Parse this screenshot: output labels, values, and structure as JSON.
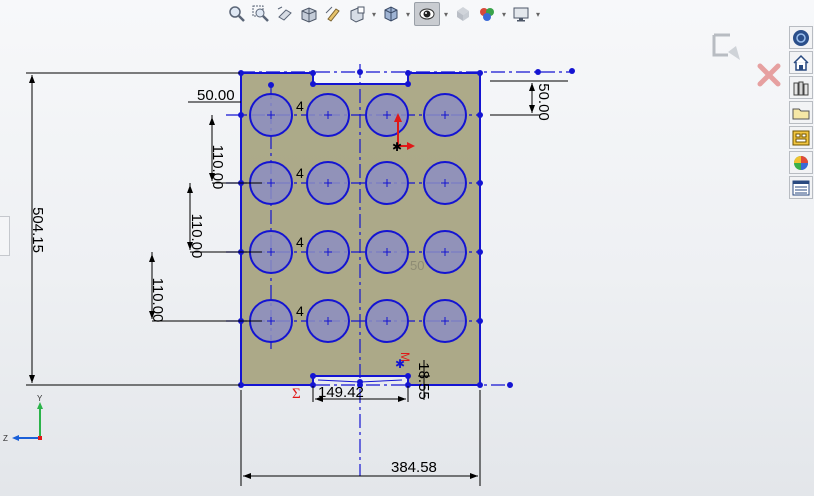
{
  "toolbar": {
    "icons": [
      "zoom-to-fit-icon",
      "zoom-to-area-icon",
      "previous-view-icon",
      "section-view-icon",
      "dynamic-annotation-icon",
      "view-orientation-icon",
      "display-style-icon",
      "hide-show-items-icon",
      "edit-appearance-icon",
      "apply-scene-icon",
      "view-settings-icon"
    ]
  },
  "taskpane": {
    "icons": [
      "solidworks-resources-icon",
      "home-icon",
      "design-library-icon",
      "file-explorer-icon",
      "view-palette-icon",
      "appearances-icon",
      "custom-properties-icon"
    ]
  },
  "sketch": {
    "dimensions": {
      "overall_height": "504.15",
      "overall_width": "384.58",
      "left_offset": "50.00",
      "top_offset": "50.00",
      "row_spacing_1": "110.00",
      "row_spacing_2": "110.00",
      "row_spacing_3": "110.00",
      "slot_width": "149.42",
      "slot_depth": "18.55",
      "hidden_dim": "50"
    },
    "instance_count_label": "4",
    "relation_sigma": "Σ",
    "relation_midpoint": "M",
    "colors": {
      "plate_fill": "#a6a37f",
      "sketch_line": "#1414d2",
      "hole_fill": "#8c8ec2",
      "dimension": "#000000"
    }
  },
  "triad": {
    "y": "Y",
    "z": "Z"
  }
}
